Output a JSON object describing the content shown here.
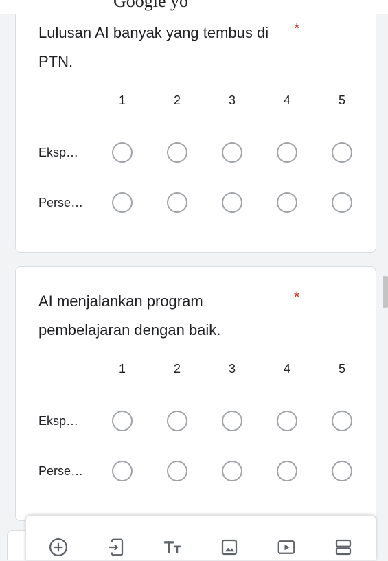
{
  "top_fragment": "Google yo",
  "questions": [
    {
      "title": "Lulusan AI banyak yang tembus di PTN.",
      "required_mark": "*",
      "columns": [
        "1",
        "2",
        "3",
        "4",
        "5"
      ],
      "rows": [
        "Eksp…",
        "Perse…"
      ]
    },
    {
      "title": "AI menjalankan program pembelajaran dengan baik.",
      "required_mark": "*",
      "columns": [
        "1",
        "2",
        "3",
        "4",
        "5"
      ],
      "rows": [
        "Eksp…",
        "Perse…"
      ]
    }
  ],
  "toolbar": {
    "items": [
      {
        "icon": "add-circle-icon"
      },
      {
        "icon": "import-question-icon"
      },
      {
        "icon": "title-text-icon"
      },
      {
        "icon": "image-icon"
      },
      {
        "icon": "video-icon"
      },
      {
        "icon": "section-icon"
      }
    ]
  },
  "colors": {
    "required": "#d93025",
    "icon": "#5f6368",
    "page_background": "#f1f3f4",
    "card_background": "#ffffff"
  }
}
